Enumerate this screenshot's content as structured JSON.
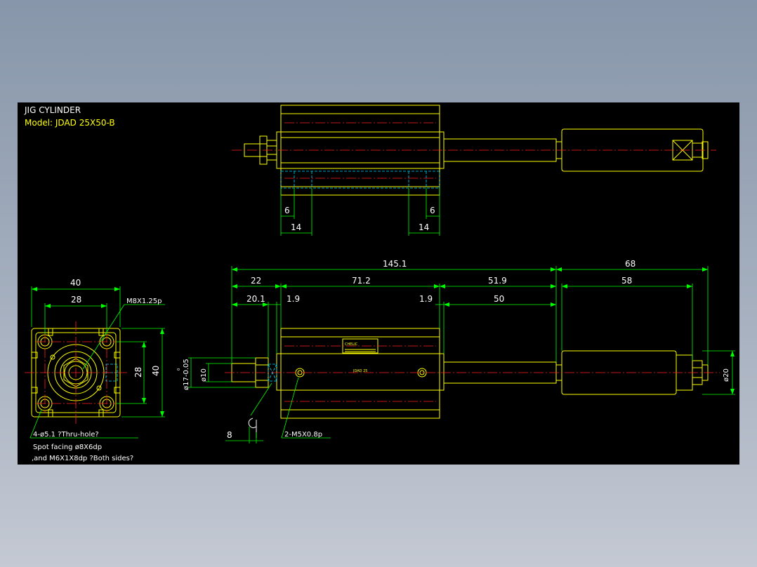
{
  "title_block": {
    "title": "JIG CYLINDER",
    "model": "Model:  JDAD 25X50-B"
  },
  "top_view": {
    "dims": [
      "6",
      "14",
      "6",
      "14"
    ]
  },
  "side_view": {
    "dims": {
      "overall": "145.1",
      "rod_end": "68",
      "rod_body": "58",
      "d22": "22",
      "d712": "71.2",
      "d519": "51.9",
      "d201": "20.1",
      "d19a": "1.9",
      "d19b": "1.9",
      "d50": "50",
      "dia10": "ø10",
      "dia17": "ø17-0.05",
      "tol": "0",
      "dia20": "ø20",
      "d8": "8"
    },
    "callouts": {
      "port": "2-M5X0.8p"
    },
    "nameplate": "CHELIC",
    "body_mark": "JDAD 25"
  },
  "front_view": {
    "dims": {
      "width": "40",
      "pitch": "28",
      "height": "40",
      "pitch_v": "28"
    },
    "callouts": {
      "thread": "M8X1.25p",
      "holes_line1": "4-ø5.1 ?Thru-hole?",
      "holes_line2": "Spot facing  ø8X6dp",
      "holes_line3": ",and  M6X1X8dp ?Both sides?"
    }
  },
  "colors": {
    "background": "#000000",
    "outline": "#ffff00",
    "dimension": "#00ff00",
    "centerline": "#ff2020",
    "hidden": "#00d8ff",
    "frame_gradient_top": "#8796aa",
    "frame_gradient_bottom": "#c4c9d3"
  }
}
